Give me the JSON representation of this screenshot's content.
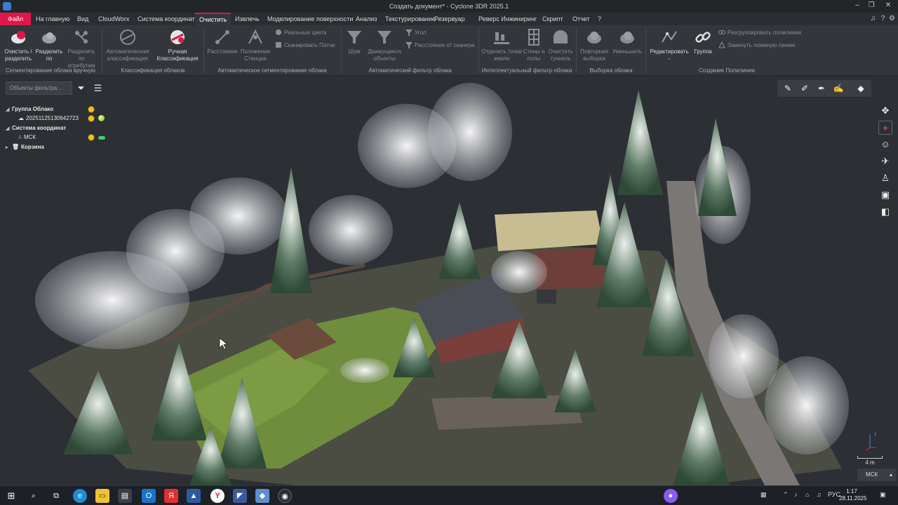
{
  "window": {
    "title": "Создать документ* - Cyclone 3DR 2025.1",
    "minimize": "–",
    "maximize": "❐",
    "close": "✕"
  },
  "menu": {
    "items": [
      "Файл",
      "На главную",
      "Вид",
      "CloudWorx",
      "Система координат",
      "Очистить",
      "Извлечь",
      "Моделирование поверхности",
      "Анализ",
      "Текстурирование",
      "Резервуар",
      "Реверс Инжиниринг",
      "Скрипт",
      "Отчет",
      "?"
    ],
    "active": "Очистить"
  },
  "ribbon": {
    "groups": [
      {
        "caption": "Сегментирование облака вручную",
        "buttons": [
          {
            "label": "Очистить / разделить",
            "enabled": true
          },
          {
            "label": "Разделить по",
            "enabled": true
          },
          {
            "label": "Разделить по атрибутам",
            "enabled": false
          }
        ]
      },
      {
        "caption": "Классификация облаков",
        "buttons": [
          {
            "label": "Автоматическая классификация",
            "enabled": false
          },
          {
            "label": "Ручная Классификация",
            "enabled": true
          }
        ]
      },
      {
        "caption": "Автоматическое сегментирование облака",
        "buttons": [
          {
            "label": "Расстояние",
            "enabled": false
          },
          {
            "label": "Положение Станции",
            "enabled": false
          }
        ],
        "small": [
          "Реальные цвета",
          "Сканировать Патчи"
        ]
      },
      {
        "caption": "Автоматический фильтр облака",
        "buttons": [
          {
            "label": "Шум",
            "enabled": false
          },
          {
            "label": "Движущиеся объекты",
            "enabled": false
          }
        ],
        "small": [
          "Угол",
          "Расстояние от сканера"
        ]
      },
      {
        "caption": "Интеллектуальный фильтр облака",
        "buttons": [
          {
            "label": "Отделить точки земли",
            "enabled": false
          },
          {
            "label": "Стены и полы",
            "enabled": false
          },
          {
            "label": "Очистить туннель",
            "enabled": false
          }
        ]
      },
      {
        "caption": "Выборка облака",
        "buttons": [
          {
            "label": "Повторная выборка",
            "enabled": false
          },
          {
            "label": "Уменьшить",
            "enabled": false
          }
        ]
      },
      {
        "caption": "Создание Полилинии",
        "buttons": [
          {
            "label": "Редактировать",
            "enabled": true
          },
          {
            "label": "Группа",
            "enabled": true
          }
        ],
        "small": [
          "Разгруппировать полилинии",
          "Замкнуть ломаную линию"
        ]
      }
    ]
  },
  "tree": {
    "filter_placeholder": "Объекты фильтра...",
    "items": [
      {
        "label": "Группа Облако",
        "bold": true
      },
      {
        "label": "20251125130642723",
        "bold": false
      },
      {
        "label": "Система координат",
        "bold": true
      },
      {
        "label": "МСК",
        "bold": false
      },
      {
        "label": "Корзина",
        "bold": true
      }
    ]
  },
  "viewport": {
    "scale_label": "4 m",
    "coord_system": "МСК"
  },
  "taskbar": {
    "language": "РУС",
    "time": "1:17",
    "date": "28.11.2025"
  }
}
